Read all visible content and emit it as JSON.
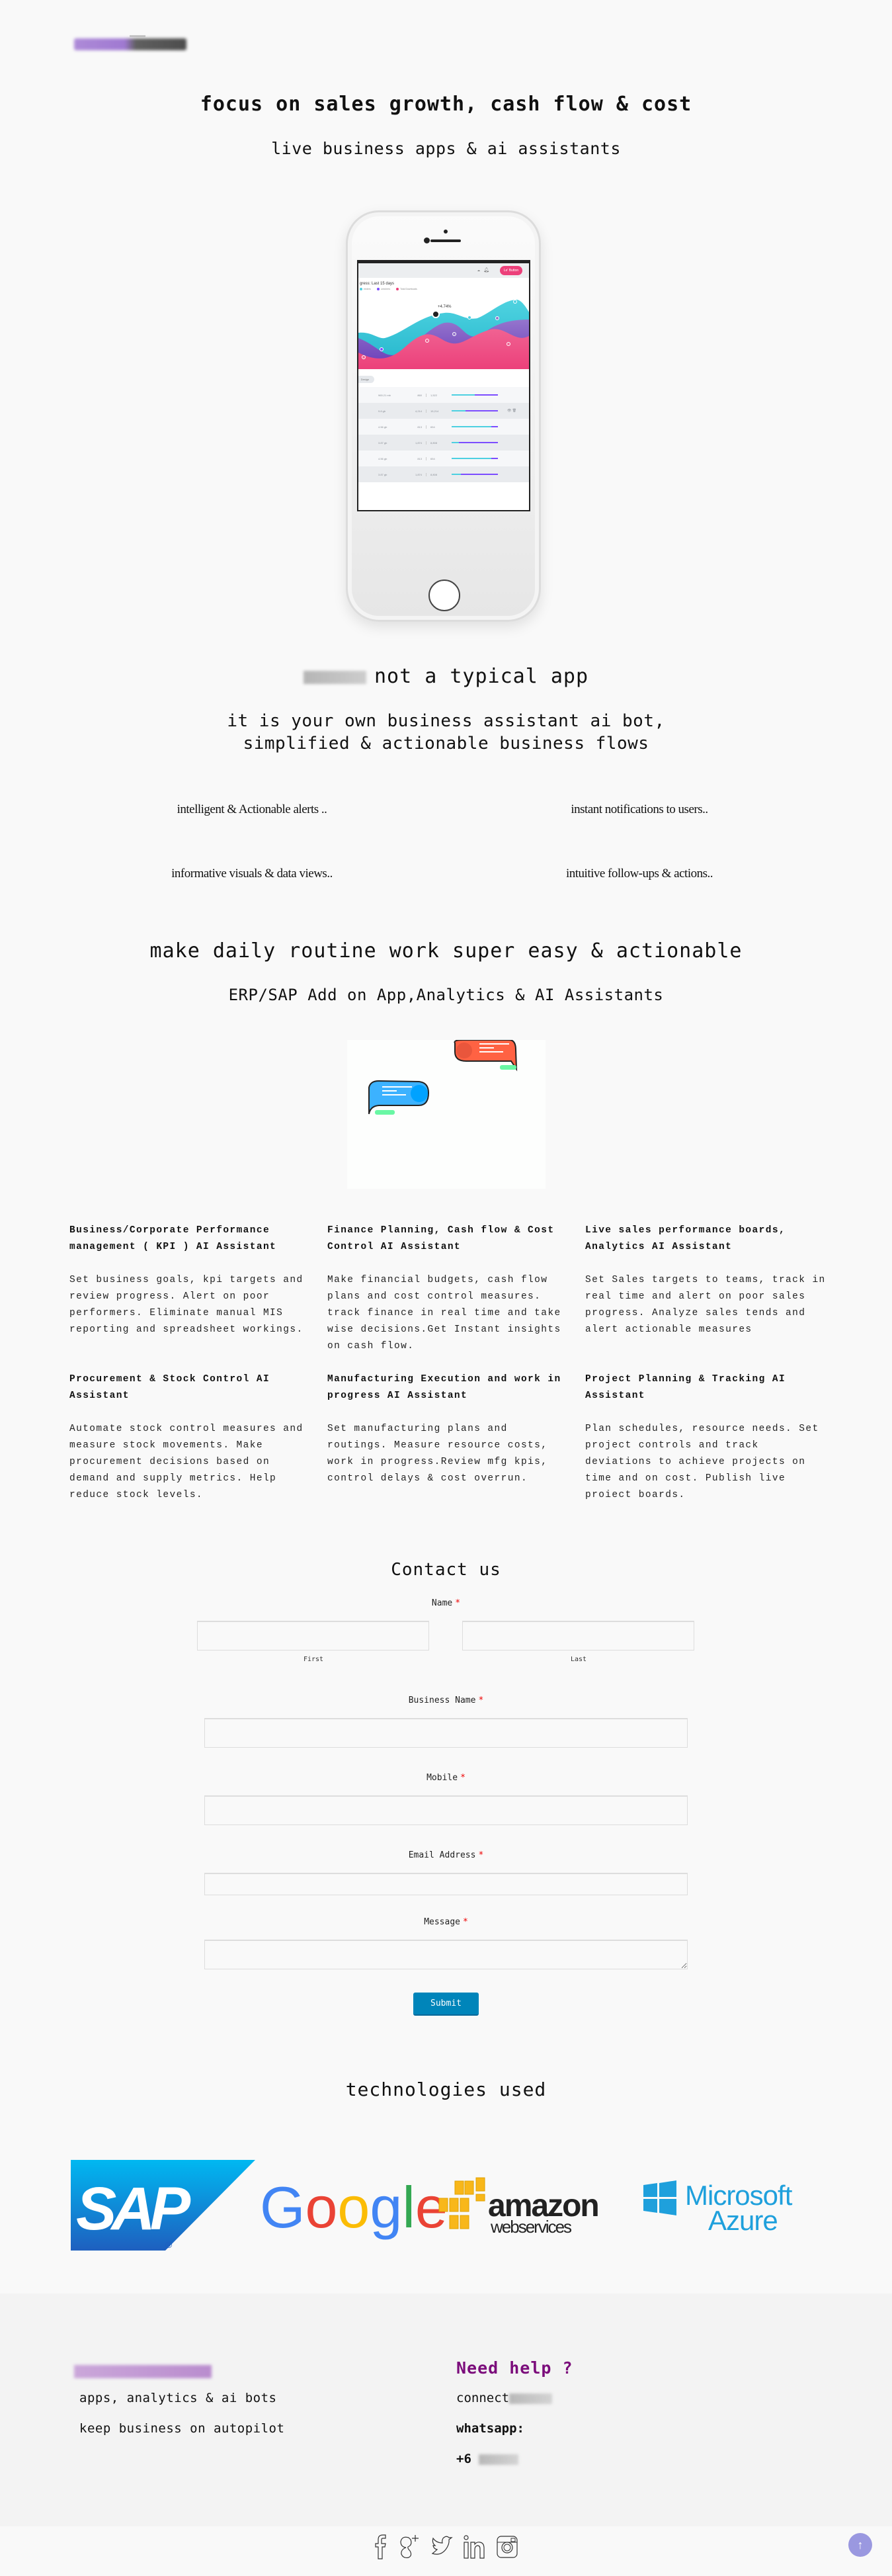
{
  "header": {
    "logo_alt": "site logo (blurred)",
    "hero_title": "focus on sales growth, cash flow & cost",
    "hero_subtitle": "live business apps & ai assistants"
  },
  "phone_mockup": {
    "header_button": "Le' Button",
    "chart_title": "gress: Last 15 days",
    "legend": [
      {
        "label": "eeders",
        "color": "#4dd0e1"
      },
      {
        "label": "Leechers",
        "color": "#7c4dff"
      },
      {
        "label": "Total Downloads",
        "color": "#ec407a"
      }
    ],
    "annotation": "+4.74%",
    "chip": "Design",
    "rows": [
      {
        "size": "965.21 mb",
        "seeds": "860",
        "downloads": "1,522",
        "seed_ratio": 0.5
      },
      {
        "size": "9.8 gb",
        "seeds": "4,214",
        "downloads": "15,214",
        "seed_ratio": 0.3
      },
      {
        "size": "4.56 gb",
        "seeds": "813",
        "downloads": "654",
        "seed_ratio": 0.85
      },
      {
        "size": "3.87 gb",
        "seeds": "1,874",
        "downloads": "8,808",
        "seed_ratio": 0.15
      },
      {
        "size": "4.56 gb",
        "seeds": "813",
        "downloads": "654",
        "seed_ratio": 0.85
      },
      {
        "size": "3.87 gb",
        "seeds": "1,874",
        "downloads": "8,808",
        "seed_ratio": 0.2
      }
    ]
  },
  "about": {
    "title_suffix": "not a typical app",
    "subtitle_line1": "it is your own business assistant ai bot,",
    "subtitle_line2": "simplified & actionable business flows",
    "features": [
      "intelligent & Actionable alerts ..",
      "instant notifications to users..",
      "informative visuals & data views..",
      "intuitive follow-ups & actions.."
    ]
  },
  "daily": {
    "title": "make daily routine work super easy & actionable",
    "subtitle": "ERP/SAP Add on App,Analytics & AI Assistants"
  },
  "assistants": [
    {
      "title": "Business/Corporate Performance management ( KPI ) AI Assistant",
      "body": "Set business goals, kpi targets and review progress. Alert on poor performers. Eliminate manual MIS reporting and spreadsheet workings."
    },
    {
      "title": "Finance Planning, Cash flow & Cost Control AI Assistant",
      "body": "Make financial budgets, cash flow plans and cost control measures. track finance in real time and take wise decisions.Get Instant insights on cash flow."
    },
    {
      "title": "Live sales performance boards, Analytics AI Assistant",
      "body": "Set Sales  targets to teams, track in real time and alert on poor sales progress.  Analyze sales tends and alert actionable measures"
    },
    {
      "title": "Procurement & Stock Control  AI Assistant",
      "body": "Automate stock control measures and measure stock movements. Make procurement decisions based on demand and  supply metrics.  Help reduce stock levels."
    },
    {
      "title": "Manufacturing Execution and work in progress AI Assistant",
      "body": "Set manufacturing plans and routings. Measure resource costs, work in progress.Review mfg kpis, control delays & cost overrun."
    },
    {
      "title": "Project Planning & Tracking AI Assistant",
      "body": "Plan schedules, resource needs. Set project controls and track deviations to achieve projects on time and on cost. Publish live proiect boards."
    }
  ],
  "contact": {
    "title": "Contact us",
    "required_mark": "*",
    "name_label": "Name",
    "first_label": "First",
    "last_label": "Last",
    "first_value": "",
    "last_value": "",
    "business_label": "Business Name",
    "business_value": "",
    "mobile_label": "Mobile",
    "mobile_value": "",
    "email_label": "Email Address",
    "email_value": "",
    "message_label": "Message",
    "message_value": "",
    "submit_label": "Submit"
  },
  "technologies": {
    "title": "technologies used",
    "logos": [
      "SAP",
      "Google",
      "amazon web services",
      "Microsoft Azure"
    ],
    "sap_text": "SAP",
    "google_letters": [
      "G",
      "o",
      "o",
      "g",
      "l",
      "e"
    ],
    "amazon_text": "amazon",
    "aws_sub": "webservices",
    "azure_line1": "Microsoft",
    "azure_line2": "Azure"
  },
  "footer": {
    "tagline1": "apps, analytics & ai bots",
    "tagline2": "keep business on autopilot",
    "help_title": "Need help ?",
    "email_prefix": "connect",
    "whatsapp_label": "whatsapp:",
    "phone_prefix": "+6",
    "social": [
      "facebook",
      "google-plus",
      "twitter",
      "linkedin",
      "instagram"
    ],
    "back_to_top": "↑"
  },
  "colors": {
    "accent_purple": "#7b0c7b",
    "submit_blue": "#0085ba",
    "to_top": "#9a98e0",
    "required": "#e00000"
  }
}
